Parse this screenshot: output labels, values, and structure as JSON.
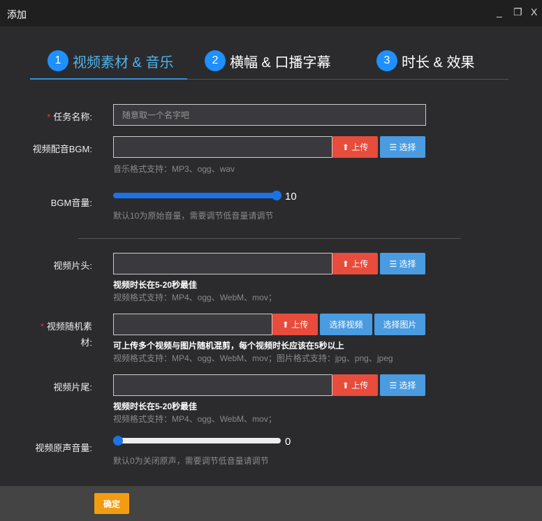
{
  "window": {
    "title": "添加",
    "minimize": "_",
    "restore": "❐",
    "close": "X"
  },
  "tabs": [
    {
      "num": "1",
      "label": "视频素材 & 音乐"
    },
    {
      "num": "2",
      "label": "横幅 & 口播字幕"
    },
    {
      "num": "3",
      "label": "时长 & 效果"
    }
  ],
  "form": {
    "task_name": {
      "label": "任务名称:",
      "placeholder": "随意取一个名字吧"
    },
    "bgm": {
      "label": "视频配音BGM:",
      "upload": "上传",
      "choose": "选择",
      "hint": "音乐格式支持：MP3、ogg、wav"
    },
    "bgm_volume": {
      "label": "BGM音量:",
      "value": "10",
      "max": 10,
      "hint": "默认10为原始音量，需要调节低音量请调节"
    },
    "intro": {
      "label": "视频片头:",
      "upload": "上传",
      "choose": "选择",
      "hint_bold": "视频时长在5-20秒最佳",
      "hint": "视频格式支持：MP4、ogg、WebM、mov；"
    },
    "random": {
      "label1": "视频随机素",
      "label2": "材:",
      "upload": "上传",
      "choose_video": "选择视频",
      "choose_image": "选择图片",
      "hint_bold": "可上传多个视频与图片随机混剪，每个视频时长应该在5秒以上",
      "hint": "视频格式支持：MP4、ogg、WebM、mov；图片格式支持：jpg、png、jpeg"
    },
    "outro": {
      "label": "视频片尾:",
      "upload": "上传",
      "choose": "选择",
      "hint_bold": "视频时长在5-20秒最佳",
      "hint": "视频格式支持：MP4、ogg、WebM、mov；"
    },
    "orig_volume": {
      "label": "视频原声音量:",
      "value": "0",
      "hint": "默认0为关闭原声，需要调节低音量请调节"
    },
    "required_mark": "*"
  },
  "footer": {
    "confirm": "确定"
  },
  "colors": {
    "upload": "#e74c3c",
    "choose": "#4a9be0",
    "confirm": "#f39c12",
    "accent": "#1e90ff"
  }
}
